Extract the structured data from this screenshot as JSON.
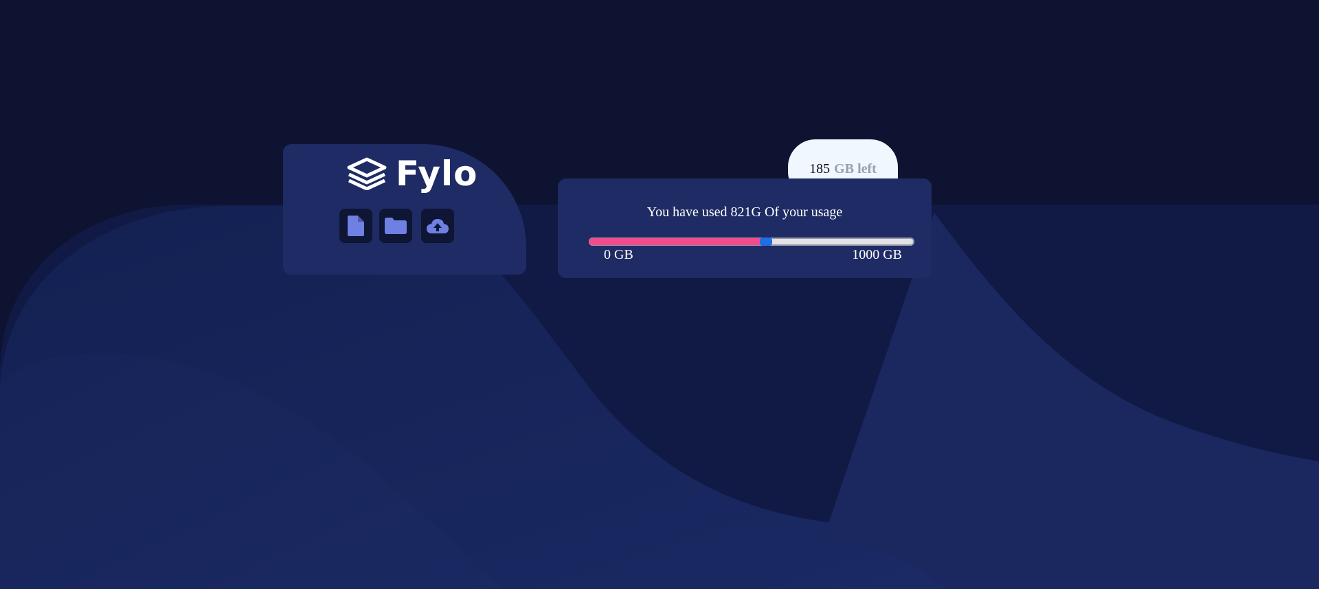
{
  "brand": {
    "name": "Fylo",
    "logo_icon": "layers-icon"
  },
  "actions": [
    {
      "icon": "document-icon"
    },
    {
      "icon": "folder-icon"
    },
    {
      "icon": "cloud-upload-icon"
    }
  ],
  "usage": {
    "summary": "You have used 821G Of your usage",
    "used_fraction": 0.53,
    "min_label": "0 GB",
    "max_label": "1000 GB"
  },
  "remaining": {
    "value": "185",
    "unit": "GB left"
  },
  "colors": {
    "page_bg": "#0d1330",
    "card_bg": "#1f2b64",
    "icon_tile_bg": "#0e1535",
    "icon_color": "#6f80e3",
    "bar_fill": "#f44b8e",
    "bar_thumb": "#1f6fe5",
    "badge_bg": "#f0f7ff"
  }
}
